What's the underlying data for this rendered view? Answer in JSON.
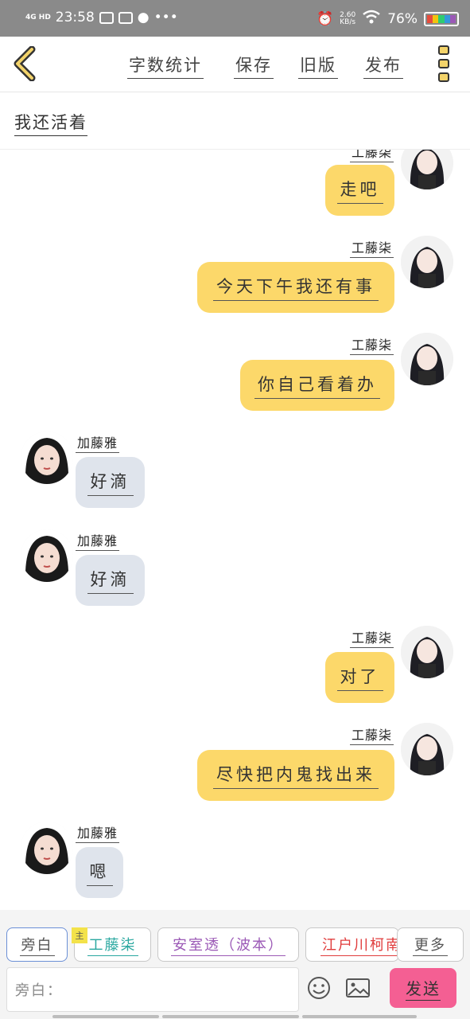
{
  "status_bar": {
    "network": "4G HD",
    "time": "23:58",
    "speed_value": "2.60",
    "speed_unit": "KB/s",
    "battery": "76%"
  },
  "toolbar": {
    "word_count": "字数统计",
    "save": "保存",
    "old_version": "旧版",
    "publish": "发布"
  },
  "story_title": "我还活着",
  "messages": [
    {
      "side": "right",
      "name": "工藤柒",
      "text": "走吧"
    },
    {
      "side": "right",
      "name": "工藤柒",
      "text": "今天下午我还有事"
    },
    {
      "side": "right",
      "name": "工藤柒",
      "text": "你自己看着办"
    },
    {
      "side": "left",
      "name": "加藤雅",
      "text": "好滴"
    },
    {
      "side": "left",
      "name": "加藤雅",
      "text": "好滴"
    },
    {
      "side": "right",
      "name": "工藤柒",
      "text": "对了"
    },
    {
      "side": "right",
      "name": "工藤柒",
      "text": "尽快把内鬼找出来"
    },
    {
      "side": "left",
      "name": "加藤雅",
      "text": "嗯"
    }
  ],
  "roles": {
    "narration": "旁白",
    "badge": "主",
    "role1": "工藤柒",
    "role2": "安室透（波本）",
    "role3": "江户川柯南",
    "more": "更多"
  },
  "input": {
    "placeholder": "旁白："
  },
  "send": "发送",
  "colors": {
    "my_bubble": "#fcd86a",
    "other_bubble": "#dfe4ec",
    "send_button": "#f45f93",
    "role1_text": "#2aa8a0",
    "role2_text": "#9b59b6",
    "role3_text": "#e03c3c"
  }
}
